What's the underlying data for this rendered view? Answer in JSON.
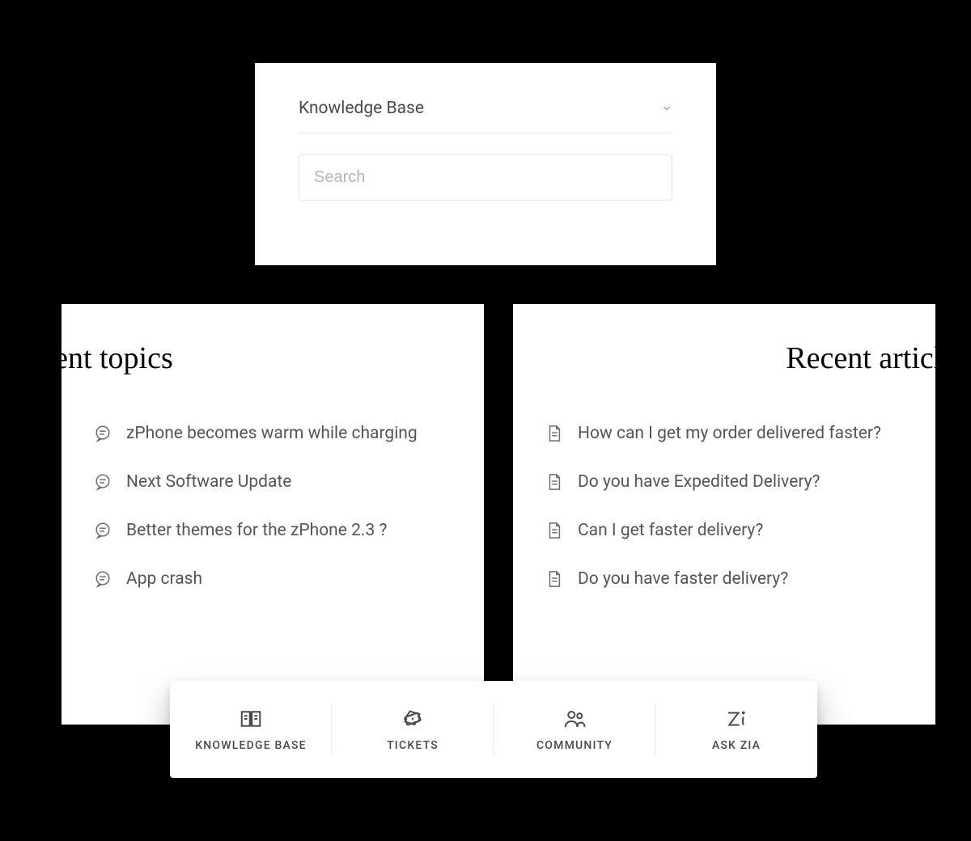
{
  "top_label": "Search",
  "search_card": {
    "dropdown_label": "Knowledge Base",
    "search_placeholder": "Search"
  },
  "left_panel": {
    "heading": "Recent topics",
    "items": [
      "zPhone becomes warm while charging",
      "Next Software Update",
      "Better themes for the zPhone 2.3 ?",
      "App crash"
    ]
  },
  "right_panel": {
    "heading": "Recent articles",
    "items": [
      "How can I get my order delivered faster?",
      "Do you have Expedited Delivery?",
      "Can I get faster delivery?",
      "Do you have faster delivery?"
    ]
  },
  "nav": [
    {
      "label": "KNOWLEDGE BASE",
      "icon": "book-icon"
    },
    {
      "label": "TICKETS",
      "icon": "ticket-icon"
    },
    {
      "label": "COMMUNITY",
      "icon": "people-icon"
    },
    {
      "label": "ASK ZIA",
      "icon": "zia-icon"
    }
  ]
}
